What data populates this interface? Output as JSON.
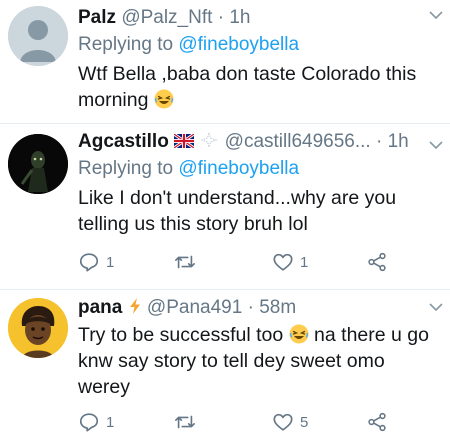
{
  "tweets": [
    {
      "name": "Palz",
      "handle": "@Palz_Nft",
      "dot": "·",
      "time": "1h",
      "reply_prefix": "Replying to",
      "reply_user": "@fineboybella",
      "text": "Wtf Bella ,baba don taste Colorado this morning"
    },
    {
      "name": "Agcastillo",
      "handle": "@castill649656...",
      "dot": "·",
      "time": "1h",
      "reply_prefix": "Replying to",
      "reply_user": "@fineboybella",
      "text": "Like I don't understand...why are you telling us this story bruh lol",
      "reply_count": "1",
      "retweet_count": "",
      "like_count": "1"
    },
    {
      "name": "pana",
      "handle": "@Pana491",
      "dot": "·",
      "time": "58m",
      "text_before": "Try to be successful too",
      "text_after": "na there u go knw say story to tell dey sweet omo werey",
      "reply_count": "1",
      "retweet_count": "",
      "like_count": "5"
    }
  ],
  "colors": {
    "link": "#1da1f2",
    "muted": "#657786",
    "text": "#14171a",
    "divider": "#e6ecf0"
  },
  "icons": [
    "chevron-down-icon",
    "reply-icon",
    "retweet-icon",
    "like-icon",
    "share-icon",
    "uk-flag-icon",
    "sparkle-icon",
    "lightning-icon",
    "laughing-emoji-icon"
  ]
}
